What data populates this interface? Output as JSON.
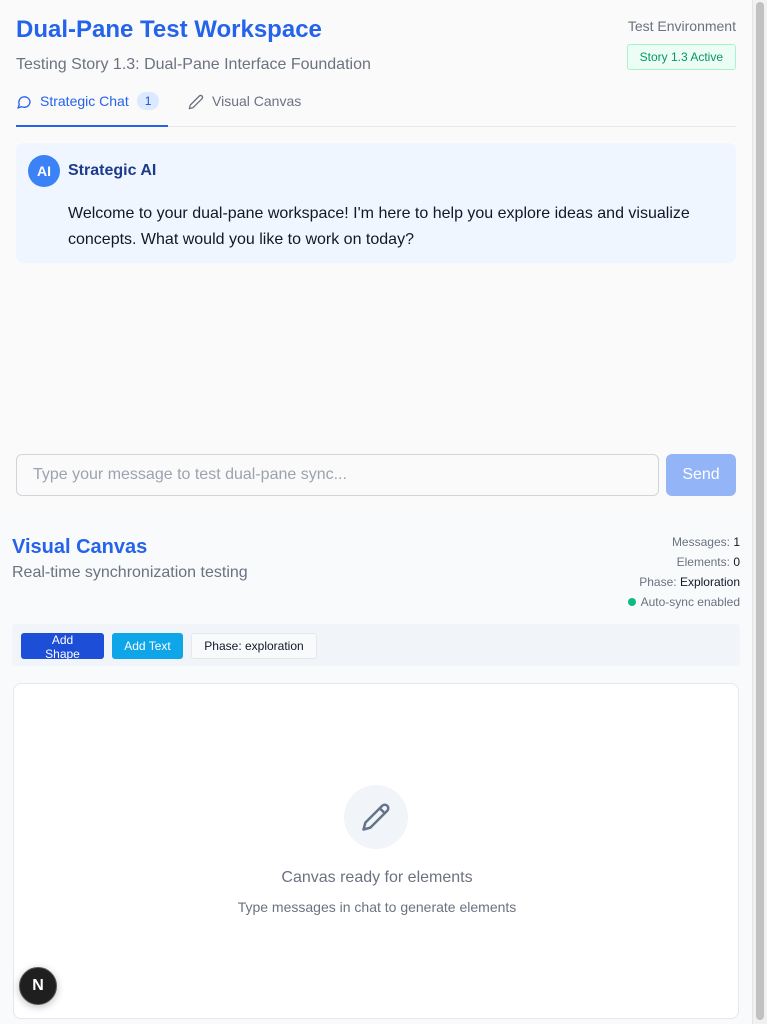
{
  "header": {
    "title": "Dual-Pane Test Workspace",
    "subtitle": "Testing Story 1.3: Dual-Pane Interface Foundation",
    "environment": "Test Environment",
    "status_badge": "Story 1.3 Active"
  },
  "tabs": [
    {
      "label": "Strategic Chat",
      "count": "1",
      "icon": "chat-bubble-icon"
    },
    {
      "label": "Visual Canvas",
      "icon": "pencil-icon"
    }
  ],
  "chat": {
    "messages": [
      {
        "avatar": "AI",
        "author": "Strategic AI",
        "text": "Welcome to your dual-pane workspace! I'm here to help you explore ideas and visualize concepts. What would you like to work on today?"
      }
    ],
    "input_placeholder": "Type your message to test dual-pane sync...",
    "send_label": "Send"
  },
  "canvas": {
    "title": "Visual Canvas",
    "subtitle": "Real-time synchronization testing",
    "stats": {
      "messages_label": "Messages:",
      "messages_value": "1",
      "elements_label": "Elements:",
      "elements_value": "0",
      "phase_label": "Phase:",
      "phase_value": "Exploration",
      "sync_label": "Auto-sync enabled"
    },
    "toolbar": {
      "add_shape": "Add Shape",
      "add_text": "Add Text",
      "phase": "Phase: exploration"
    },
    "empty_state": {
      "title": "Canvas ready for elements",
      "subtitle": "Type messages in chat to generate elements",
      "icon": "pencil-icon"
    }
  },
  "dev_badge": "N",
  "colors": {
    "accent": "#2563eb",
    "sync_ok": "#10b981",
    "send_disabled": "#93b4f7"
  }
}
